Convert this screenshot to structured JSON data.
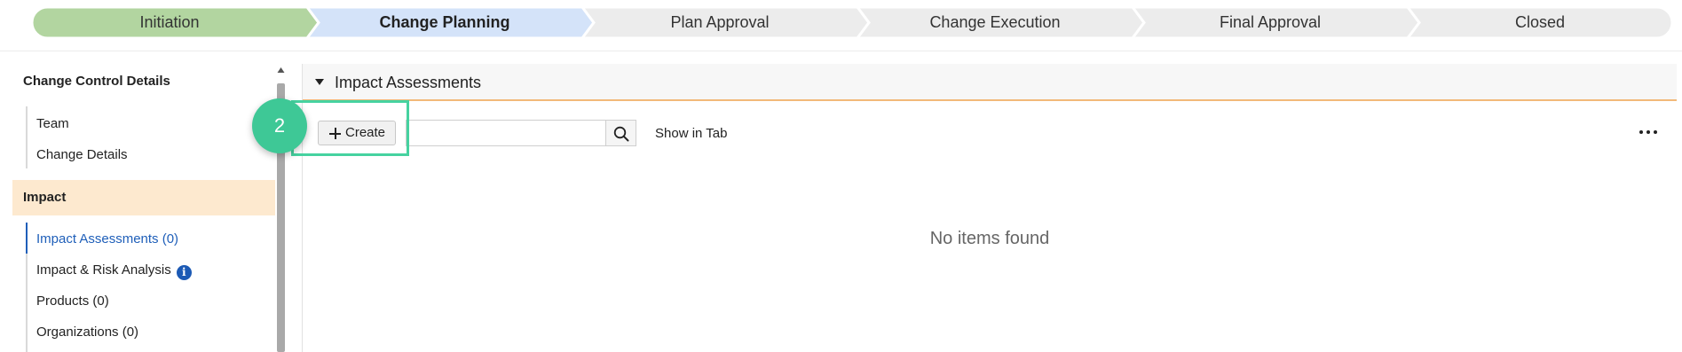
{
  "stepper": {
    "steps": [
      {
        "label": "Initiation",
        "state": "completed"
      },
      {
        "label": "Change Planning",
        "state": "current"
      },
      {
        "label": "Plan Approval",
        "state": "pending"
      },
      {
        "label": "Change Execution",
        "state": "pending"
      },
      {
        "label": "Final Approval",
        "state": "pending"
      },
      {
        "label": "Closed",
        "state": "pending"
      }
    ],
    "colors": {
      "completed": "#b2d5a0",
      "current": "#d4e3f9",
      "pending": "#ececec"
    }
  },
  "sidebar": {
    "sections": [
      {
        "heading": "Change Control Details",
        "items": [
          "Team",
          "Change Details"
        ]
      },
      {
        "heading": "Impact",
        "items": [
          "Impact Assessments (0)",
          "Impact & Risk Analysis",
          "Products (0)",
          "Organizations (0)"
        ]
      }
    ],
    "selected_item": "Impact Assessments (0)",
    "info_icon_label": "i",
    "selected_color": "#1f5fb9",
    "active_section_bg": "#fde9cf"
  },
  "panel": {
    "title": "Impact Assessments",
    "accent_color": "#f2b979",
    "toolbar": {
      "create_label": "Create",
      "search_value": "",
      "show_in_tab_label": "Show in Tab"
    },
    "empty_message": "No items found"
  },
  "tutorial": {
    "step_number": "2",
    "marker_color": "#3ec896",
    "highlight_color": "#46d2a0"
  }
}
